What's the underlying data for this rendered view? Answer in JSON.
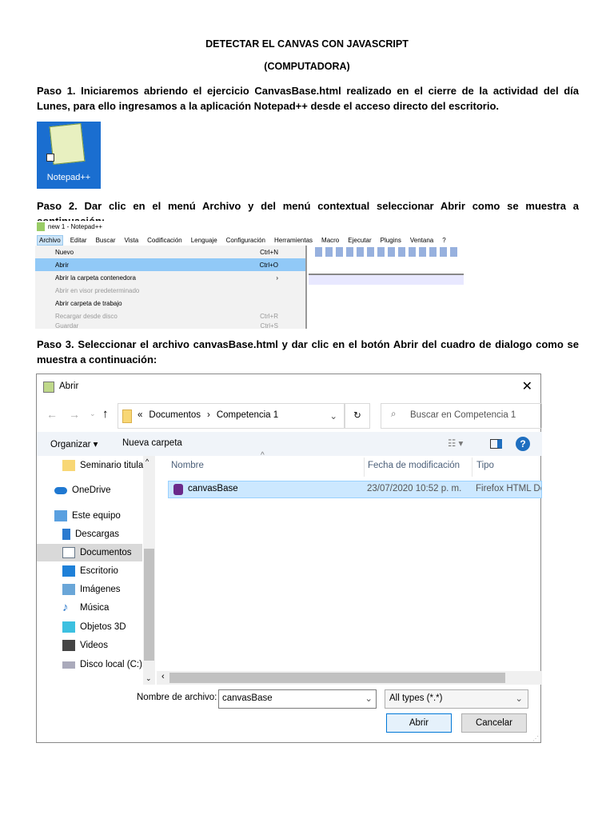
{
  "doc": {
    "title": "DETECTAR EL CANVAS CON JAVASCRIPT",
    "subtitle": "(COMPUTADORA)",
    "paso1": "Paso 1. Iniciaremos abriendo el ejercicio CanvasBase.html realizado en el cierre de la actividad del día Lunes, para ello ingresamos a la aplicación Notepad++ desde el acceso directo del escritorio.",
    "icon_label": "Notepad++",
    "paso2": "Paso 2. Dar clic en el menú Archivo y del menú contextual seleccionar Abrir como se muestra a continuación:",
    "paso3": "Paso 3. Seleccionar el archivo canvasBase.html y dar clic en el botón Abrir del cuadro de dialogo como se muestra a continuación:"
  },
  "npp": {
    "title": "new 1 - Notepad++",
    "menu": [
      "Archivo",
      "Editar",
      "Buscar",
      "Vista",
      "Codificación",
      "Lenguaje",
      "Configuración",
      "Herramientas",
      "Macro",
      "Ejecutar",
      "Plugins",
      "Ventana",
      "?"
    ],
    "items": [
      {
        "label": "Nuevo",
        "shortcut": "Ctrl+N"
      },
      {
        "label": "Abrir",
        "shortcut": "Ctrl+O"
      },
      {
        "label": "Abrir la carpeta contenedora",
        "shortcut": "›"
      },
      {
        "label": "Abrir en visor predeterminado",
        "shortcut": ""
      },
      {
        "label": "Abrir carpeta de trabajo",
        "shortcut": ""
      },
      {
        "label": "Recargar desde disco",
        "shortcut": "Ctrl+R"
      },
      {
        "label": "Guardar",
        "shortcut": "Ctrl+S"
      }
    ]
  },
  "dialog": {
    "title": "Abrir",
    "path": [
      "«",
      "Documentos",
      "›",
      "Competencia 1"
    ],
    "search_placeholder": "Buscar en Competencia 1",
    "organize": "Organizar ▾",
    "new_folder": "Nueva carpeta",
    "sidebar": [
      "Seminario titulac",
      "OneDrive",
      "Este equipo",
      "Descargas",
      "Documentos",
      "Escritorio",
      "Imágenes",
      "Música",
      "Objetos 3D",
      "Videos",
      "Disco local (C:)"
    ],
    "columns": [
      "Nombre",
      "Fecha de modificación",
      "Tipo"
    ],
    "file": {
      "name": "canvasBase",
      "date": "23/07/2020 10:52 p. m.",
      "type": "Firefox HTML Do"
    },
    "filename_label": "Nombre de archivo:",
    "filename_value": "canvasBase",
    "filter": "All types (*.*)",
    "open": "Abrir",
    "cancel": "Cancelar"
  }
}
